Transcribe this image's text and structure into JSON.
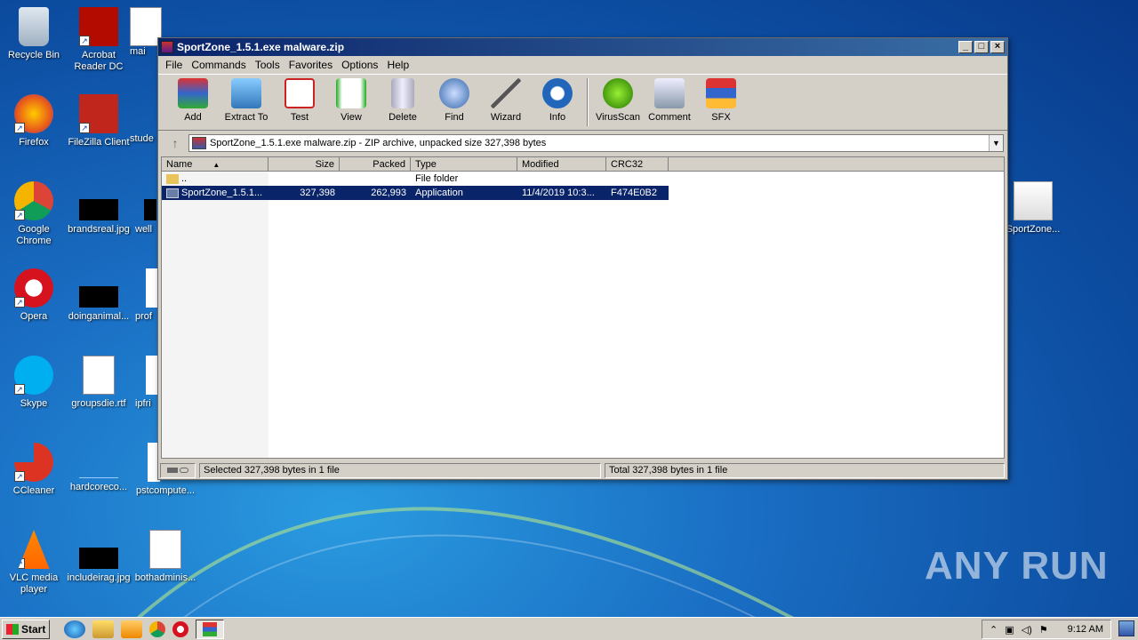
{
  "desktop": {
    "icons": [
      {
        "label": "Recycle Bin"
      },
      {
        "label": "Acrobat Reader DC"
      },
      {
        "label": "mai"
      },
      {
        "label": "Firefox"
      },
      {
        "label": "FileZilla Client"
      },
      {
        "label": "stude"
      },
      {
        "label": "Google Chrome"
      },
      {
        "label": "brandsreal.jpg"
      },
      {
        "label": "well"
      },
      {
        "label": "Opera"
      },
      {
        "label": "doinganimal..."
      },
      {
        "label": "prof"
      },
      {
        "label": "Skype"
      },
      {
        "label": "groupsdie.rtf"
      },
      {
        "label": "ipfri"
      },
      {
        "label": "CCleaner"
      },
      {
        "label": "hardcoreco..."
      },
      {
        "label": "pstcompute..."
      },
      {
        "label": "VLC media player"
      },
      {
        "label": "includeirag.jpg"
      },
      {
        "label": "bothadminis..."
      },
      {
        "label": "SportZone..."
      }
    ]
  },
  "window": {
    "title": "SportZone_1.5.1.exe malware.zip",
    "menu": [
      "File",
      "Commands",
      "Tools",
      "Favorites",
      "Options",
      "Help"
    ],
    "toolbar": [
      "Add",
      "Extract To",
      "Test",
      "View",
      "Delete",
      "Find",
      "Wizard",
      "Info",
      "VirusScan",
      "Comment",
      "SFX"
    ],
    "address": "SportZone_1.5.1.exe malware.zip - ZIP archive, unpacked size 327,398 bytes",
    "columns": [
      "Name",
      "Size",
      "Packed",
      "Type",
      "Modified",
      "CRC32"
    ],
    "rows": [
      {
        "name": "..",
        "size": "",
        "packed": "",
        "type": "File folder",
        "modified": "",
        "crc": ""
      },
      {
        "name": "SportZone_1.5.1...",
        "size": "327,398",
        "packed": "262,993",
        "type": "Application",
        "modified": "11/4/2019 10:3...",
        "crc": "F474E0B2"
      }
    ],
    "status_left": "Selected 327,398 bytes in 1 file",
    "status_right": "Total 327,398 bytes in 1 file"
  },
  "taskbar": {
    "start_label": "Start",
    "clock": "9:12 AM"
  },
  "watermark": "ANY RUN"
}
